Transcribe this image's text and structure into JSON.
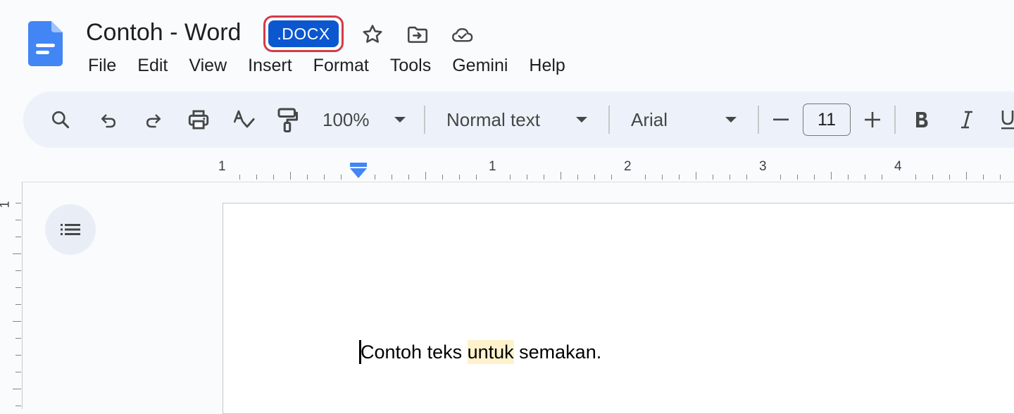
{
  "header": {
    "doc_title": "Contoh - Word",
    "file_badge": ".DOCX",
    "icons": [
      "star-icon",
      "move-to-folder-icon",
      "cloud-saved-icon"
    ]
  },
  "menu": [
    "File",
    "Edit",
    "View",
    "Insert",
    "Format",
    "Tools",
    "Gemini",
    "Help"
  ],
  "toolbar": {
    "zoom": "100%",
    "style": "Normal text",
    "font": "Arial",
    "font_size": "11",
    "icons": [
      "search-icon",
      "undo-icon",
      "redo-icon",
      "print-icon",
      "spellcheck-icon",
      "paint-format-icon",
      "decrease-font-icon",
      "increase-font-icon",
      "bold-icon",
      "italic-icon",
      "underline-icon"
    ]
  },
  "ruler": {
    "numbers": [
      "1",
      "1",
      "2",
      "3",
      "4"
    ],
    "vertical_number": "1"
  },
  "document": {
    "text_before": "Contoh teks ",
    "text_highlight": "untuk",
    "text_after": " semakan."
  },
  "colors": {
    "accent": "#0b57d0",
    "badge_outline": "#d33b4a",
    "highlight": "#fef2cd",
    "toolbar_bg": "#edf2fa"
  }
}
